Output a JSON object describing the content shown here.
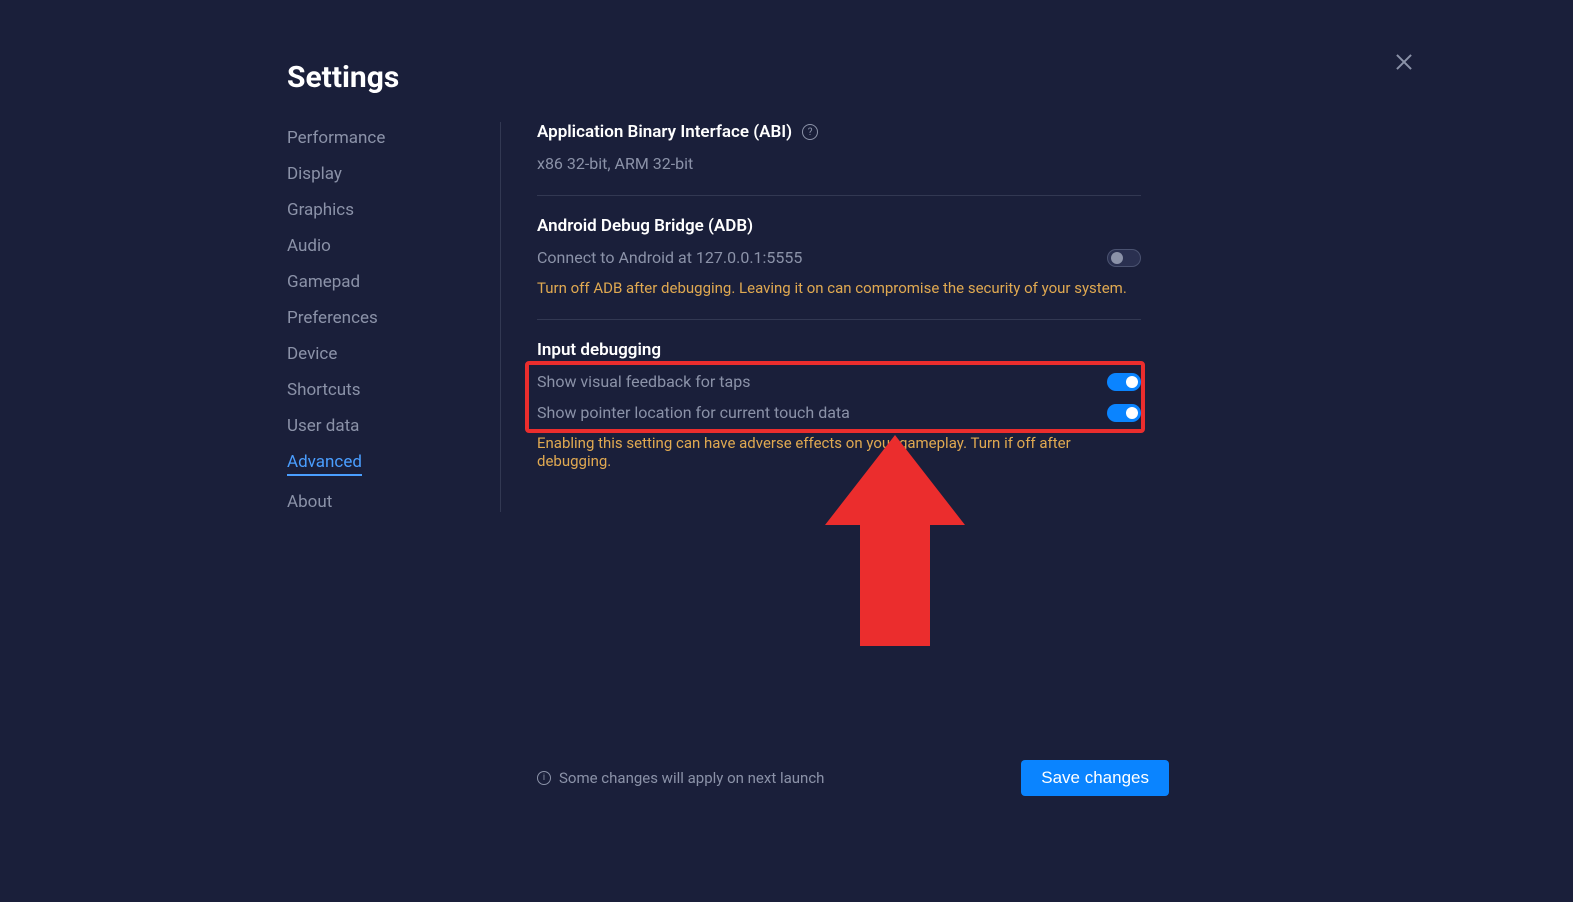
{
  "title": "Settings",
  "sidebar": {
    "items": [
      {
        "label": "Performance",
        "id": "performance"
      },
      {
        "label": "Display",
        "id": "display"
      },
      {
        "label": "Graphics",
        "id": "graphics"
      },
      {
        "label": "Audio",
        "id": "audio"
      },
      {
        "label": "Gamepad",
        "id": "gamepad"
      },
      {
        "label": "Preferences",
        "id": "preferences"
      },
      {
        "label": "Device",
        "id": "device"
      },
      {
        "label": "Shortcuts",
        "id": "shortcuts"
      },
      {
        "label": "User data",
        "id": "user-data"
      },
      {
        "label": "Advanced",
        "id": "advanced"
      },
      {
        "label": "About",
        "id": "about"
      }
    ],
    "active": "advanced"
  },
  "content": {
    "abi": {
      "title": "Application Binary Interface (ABI)",
      "value": "x86 32-bit, ARM 32-bit"
    },
    "adb": {
      "title": "Android Debug Bridge (ADB)",
      "setting_label": "Connect to Android at 127.0.0.1:5555",
      "warning": "Turn off ADB after debugging. Leaving it on can compromise the security of your system."
    },
    "input_debugging": {
      "title": "Input debugging",
      "taps_label": "Show visual feedback for taps",
      "pointer_label": "Show pointer location for current touch data",
      "warning": "Enabling this setting can have adverse effects on your gameplay. Turn if off after debugging."
    }
  },
  "footer": {
    "note": "Some changes will apply on next launch",
    "save_label": "Save changes"
  }
}
